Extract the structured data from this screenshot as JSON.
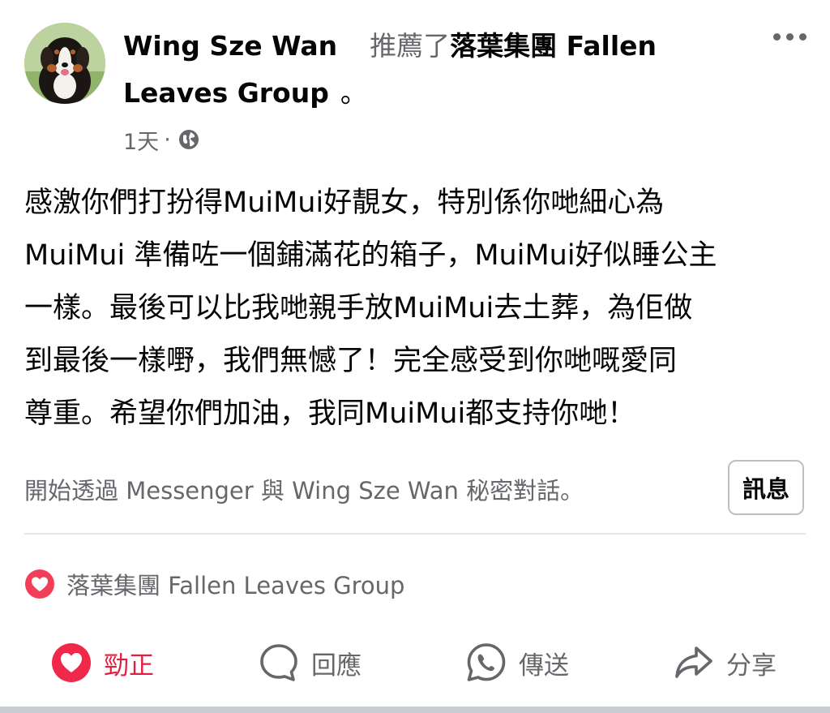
{
  "post": {
    "author": "Wing Sze Wan",
    "recommended_text": "推薦了",
    "page_name_line1": "落葉集團 Fallen",
    "page_name_line2": "Leaves Group",
    "period": "。",
    "time": "1天",
    "separator": "·",
    "audience_icon": "globe-icon",
    "body": "感激你們打扮得MuiMui好靚女，特別係你哋細心為\nMuiMui 準備咗一個鋪滿花的箱子，MuiMui好似睡公主\n一樣。最後可以比我哋親手放MuiMui去土葬，為佢做\n到最後一樣嘢，我們無憾了！完全感受到你哋嘅愛同\n尊重。希望你們加油，我同MuiMui都支持你哋！"
  },
  "messenger": {
    "prompt": "開始透過 Messenger 與 Wing Sze Wan 秘密對話。",
    "button_label": "訊息"
  },
  "reaction": {
    "icon": "heart-reaction-icon",
    "text": "落葉集團 Fallen Leaves Group"
  },
  "actions": {
    "like": "勁正",
    "comment": "回應",
    "send": "傳送",
    "share": "分享"
  },
  "colors": {
    "like_red": "#e41e3f",
    "secondary_text": "#65676b",
    "primary_text": "#050505"
  }
}
